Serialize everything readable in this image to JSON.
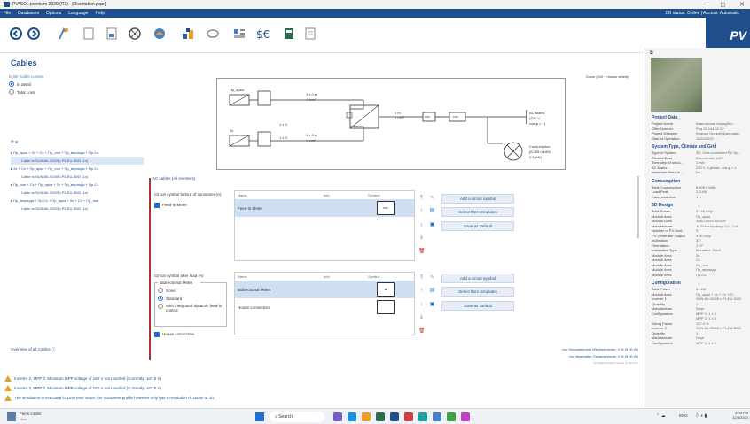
{
  "window": {
    "title": "PV*SOL premium 2020 (R3) - [Disertation.pvprj]",
    "min": "–",
    "max": "◻",
    "close": "✕"
  },
  "menu": {
    "items": [
      "File",
      "Databases",
      "Options",
      "Language",
      "Help"
    ],
    "status": "DB status: Online | Access: Automatic"
  },
  "toolbar": {
    "icons": [
      "back-icon",
      "forward-icon",
      "location-icon",
      "document-icon",
      "page-icon",
      "module-icon",
      "3d-icon",
      "inverter-icon",
      "cable-icon",
      "plan-icon",
      "financial-icon",
      "battery-icon",
      "report-icon"
    ],
    "logo": "PV"
  },
  "page": {
    "title": "Cables"
  },
  "left": {
    "section": "Enter Cable Losses",
    "options": [
      {
        "label": "In detail",
        "selected": true
      },
      {
        "label": "Total Loss",
        "selected": false
      }
    ],
    "tree": [
      {
        "text": "Пр_арка + Зх + Сх + Пр_лоп + Пр_веранда + Пр-Сх",
        "level": 0
      },
      {
        "text": "Cable to SUN-6K-SG05 LP3-EU-SM2 (1x)",
        "level": 1,
        "selected": true
      },
      {
        "text": "Зх + Сх + Пр_арка + Пр_лоп + Пр_веранда + Пр-Сх",
        "level": 0
      },
      {
        "text": "Cable to SUN-6K-SG05 LP3-EU-SM2 (1x)",
        "level": 1
      },
      {
        "text": "Пр_лоп + Сх + Пр_арка + Зх + Пр_веранда + Пр-Сх",
        "level": 0
      },
      {
        "text": "Cable to SUN-6K-SG05 LP3-EU-SM2 (1x)",
        "level": 1
      },
      {
        "text": "Пр_веранда + Пр-Сх + Пр_арка + Зх + Сх + Пр_лоп",
        "level": 0
      },
      {
        "text": "Cable to SUN-6K-SG05 LP3-EU-SM2 (1x)",
        "level": 1
      }
    ],
    "overview": "Overview of all Cables"
  },
  "diagram": {
    "zoom": "Zoom (Ctrl + mouse wheel)",
    "string1": "Пр_арка",
    "string2": "Зх",
    "cable1": "1 x 0 m",
    "cable1b": "4 mm²",
    "cable2": "1 x 0 m",
    "cable2b": "4 mm²",
    "mult1": "1 x 9",
    "mult2": "1 x 9",
    "ac_cable": "0 m",
    "ac_cable2": "4 mm²",
    "mains": "AC Mains",
    "mains2": "(230 V,",
    "mains3": "cos φ = 1)",
    "consumption": "Consumption",
    "consumption2": "(8,495.0 kWh,",
    "consumption3": "2.3 kW)",
    "meter1": "kWh",
    "meter2": "kWh"
  },
  "ac": {
    "header": "AC cables (All inverters)",
    "before_title": "Circuit symbol before of consumer (A)",
    "after_title": "Circuit symbol after load (A)",
    "col_name": "Name",
    "col_info": "Info",
    "col_symbol": "Symbol",
    "feed_in_meter_check": "Feed-in Meter",
    "feed_in_row": "Feed-in Meter",
    "symbol_text": "kWh",
    "bidir_group": "Bidirectional Meter",
    "bidir_options": [
      {
        "label": "None",
        "selected": false
      },
      {
        "label": "Standard",
        "selected": true
      },
      {
        "label": "With integrated dynamic feed-in control",
        "selected": false
      }
    ],
    "bidir_row": "Bidirectional Meter",
    "house_row": "House connection",
    "house_check": "House connection",
    "buttons": {
      "add": "Add a circuit symbol",
      "templates": "Select from templates",
      "save": "Save as Default"
    },
    "notes": [
      "xxx Gesamtverlust Wechselrichter: 2 % (5.00 W)",
      "xxx Maximaler Gesamtverlust: 2 % (5.00 W)",
      "All detailed losses caused by the STC"
    ]
  },
  "right": {
    "project_h": "Project Data",
    "project": [
      [
        "Project Name",
        "Комплексне передбач..."
      ],
      [
        "Offer Number",
        "Proj 20 144 02 02"
      ],
      [
        "Project Designer",
        "Власюк Олексій Дмирович"
      ],
      [
        "Start of Operation",
        "11/22/2020"
      ]
    ],
    "system_h": "System Type, Climate and Grid",
    "system": [
      [
        "Type of System",
        "3D, Grid-connected PV Sy..."
      ],
      [
        "Climate Data",
        "Zolochevka, UKR"
      ],
      [
        "Time step of simul...",
        "1 min"
      ],
      [
        "AC Mains",
        "230 V, 3-phase, cos φ = 1"
      ],
      [
        "Maximum Feed-in ...",
        "No"
      ]
    ],
    "cons_h": "Consumption",
    "cons": [
      [
        "Total Consumption",
        "8,495.0 kWh"
      ],
      [
        "Load Peak",
        "2.3 kW"
      ],
      [
        "Data resolution",
        "1 h"
      ]
    ],
    "design_h": "3D Design",
    "design": [
      [
        "Total Power",
        "27.40 kWp"
      ],
      [
        "Module Area",
        "Пр_арка"
      ],
      [
        "Module Data",
        "JAM72S09-400/LR"
      ],
      [
        "Manufacturer",
        "JA Solar Holdings Co., Ltd."
      ],
      [
        "Number of PV Mod...",
        "9"
      ],
      [
        "PV Generator Output",
        "4.00 kWp"
      ],
      [
        "Inclination",
        "33°"
      ],
      [
        "Orientation",
        "170°"
      ],
      [
        "Installation Type",
        "Mounted - Roof"
      ],
      [
        "Module Area",
        "Зх"
      ],
      [
        "Module Area",
        "Сх"
      ],
      [
        "Module Area",
        "Пр_лоп"
      ],
      [
        "Module Area",
        "Пр_веранда"
      ],
      [
        "Module Area",
        "Пр-Сх"
      ]
    ],
    "config_h": "Configuration",
    "config": [
      [
        "Total Power",
        "24 kW"
      ],
      [
        "Module Area",
        "Пр_арка + Зх + Сх + П..."
      ],
      [
        "Inverter 1",
        "SUN-6K-SG05 LP3-EU-SM2"
      ],
      [
        "Quantity",
        "1"
      ],
      [
        "Manufacturer",
        "Deye"
      ],
      [
        "Configuration",
        "MPP 1: 1 x 9"
      ],
      [
        "",
        "MPP 2: 1 x 9"
      ],
      [
        "Sizing Factor",
        "127.0 %"
      ],
      [
        "Inverter 2",
        "SUN-6K-SG05 LP3-EU-SM2"
      ],
      [
        "Quantity",
        "1"
      ],
      [
        "Manufacturer",
        "Deye"
      ],
      [
        "Configuration",
        "MPP 1: 1 x 9"
      ]
    ]
  },
  "warnings": [
    "Inverter 2, MPP 2:   Minimum MPP voltage of 180 V not reached (Currently: 167.8 V)",
    "Inverter 3, MPP 2:   Minimum MPP voltage of 180 V not reached (Currently: 167.8 V)",
    "The simulation is executed in 1min time steps, the consumer profile however only has a resolution of 15min or 1h."
  ],
  "taskbar": {
    "weather": "Feels colder",
    "weather2": "Now",
    "search": "Search",
    "lang": "ENG",
    "time": "4:04 PM",
    "date": "12/8/2023"
  }
}
